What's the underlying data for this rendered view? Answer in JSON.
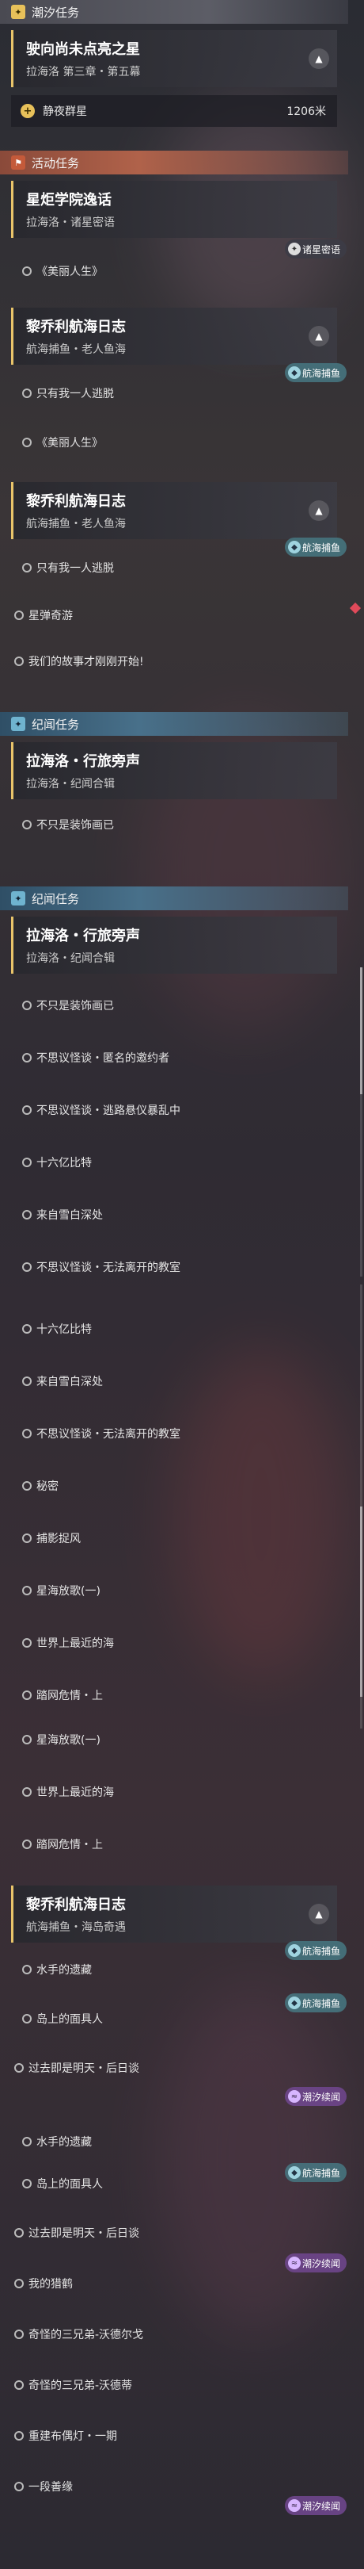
{
  "tide": {
    "title": "潮汐任务",
    "quest_title": "驶向尚未点亮之星",
    "quest_sub": "拉海洛 第三章・第五幕",
    "objective": "静夜群星",
    "distance": "1206米"
  },
  "activity": {
    "title": "活动任务",
    "quest_title": "星炬学院逸话",
    "quest_sub": "拉海洛・诸星密语",
    "badge": "诸星密语",
    "row1": "《美丽人生》"
  },
  "voyage1": {
    "title": "黎乔利航海日志",
    "sub": "航海捕鱼・老人鱼海",
    "badge": "航海捕鱼",
    "row1": "只有我一人逃脱",
    "row2": "《美丽人生》"
  },
  "voyage2": {
    "title": "黎乔利航海日志",
    "sub": "航海捕鱼・老人鱼海",
    "badge": "航海捕鱼",
    "row1": "只有我一人逃脱",
    "row2": "星弹奇游",
    "row3": "我们的故事才刚刚开始!"
  },
  "era1": {
    "title": "纪闻任务",
    "quest_title": "拉海洛・行旅旁声",
    "quest_sub": "拉海洛・纪闻合辑",
    "row1": "不只是装饰画已"
  },
  "era2": {
    "title": "纪闻任务",
    "quest_title": "拉海洛・行旅旁声",
    "quest_sub": "拉海洛・纪闻合辑",
    "rows": [
      "不只是装饰画已",
      "不思议怪谈・匿名的邀约者",
      "不思议怪谈・逃路悬仪暴乱中",
      "十六亿比特",
      "来自雪白深处",
      "不思议怪谈・无法离开的教室"
    ]
  },
  "era3": {
    "rows": [
      "十六亿比特",
      "来自雪白深处",
      "不思议怪谈・无法离开的教室",
      "秘密",
      "捕影捉风",
      "星海放歌(一)",
      "世界上最近的海",
      "踏网危情・上"
    ]
  },
  "era4": {
    "rows": [
      "星海放歌(一)",
      "世界上最近的海",
      "踏网危情・上"
    ]
  },
  "voyage3": {
    "title": "黎乔利航海日志",
    "sub": "航海捕鱼・海岛奇遇",
    "badge": "航海捕鱼",
    "badge2": "航海捕鱼",
    "badge3": "潮汐续闻",
    "rows": [
      "水手的遗藏",
      "岛上的面具人",
      "过去即是明天・后日谈"
    ]
  },
  "voyage4": {
    "badge": "航海捕鱼",
    "badge2": "潮汐续闻",
    "badge3": "潮汐续闻",
    "rows": [
      "水手的遗藏",
      "岛上的面具人",
      "过去即是明天・后日谈",
      "我的猎鹤",
      "奇怪的三兄弟-沃德尔戈",
      "奇怪的三兄弟-沃德蒂",
      "重建布偶灯・一期",
      "一段善缘"
    ]
  }
}
